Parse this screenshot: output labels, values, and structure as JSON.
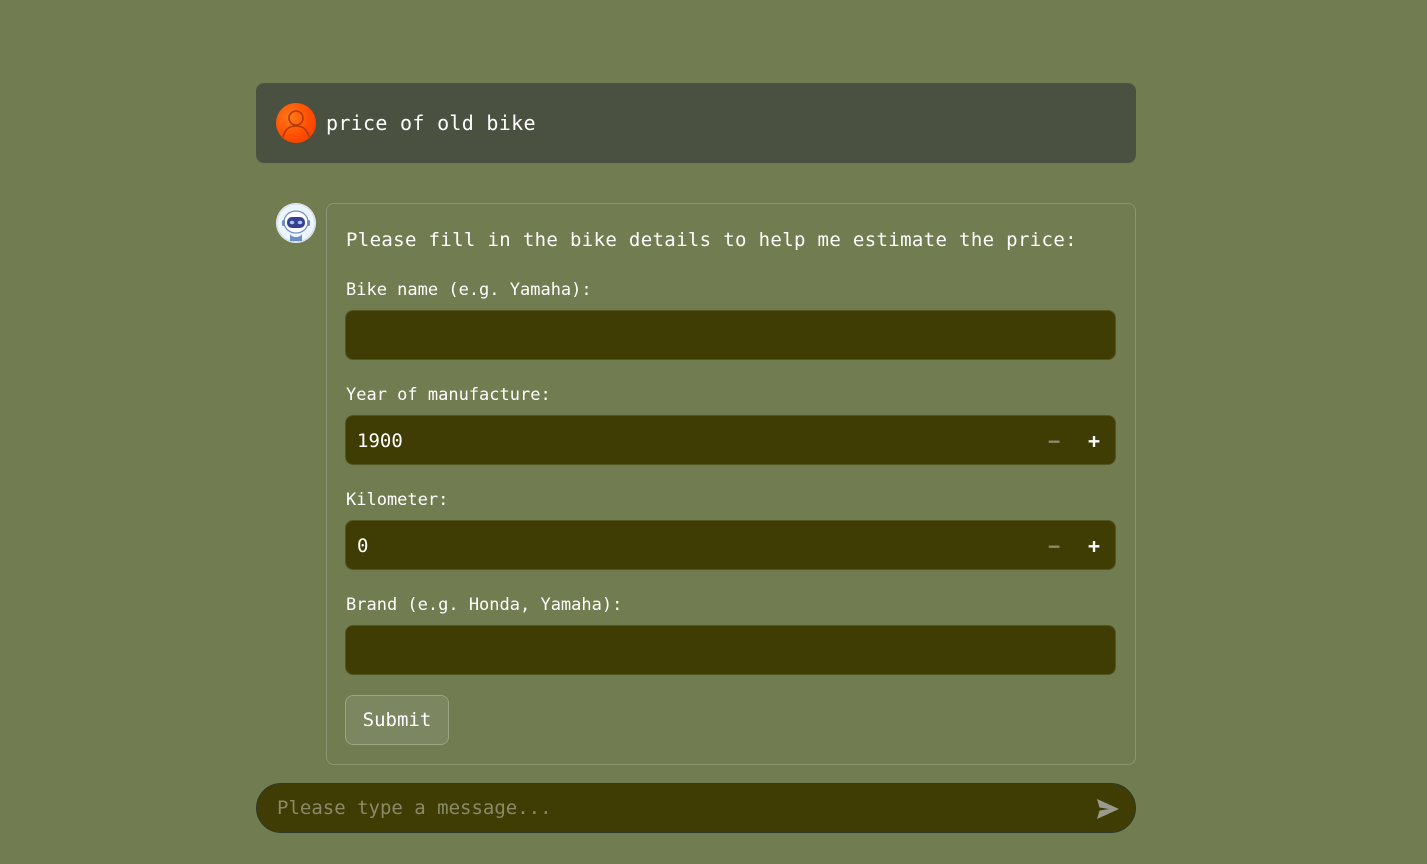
{
  "conversation": {
    "user_message": {
      "text": "price of old bike",
      "avatar_icon": "user-icon",
      "avatar_color": "#ff5a00"
    },
    "bot_message": {
      "avatar_icon": "robot-icon",
      "intro": "Please fill in the bike details to help me estimate the price:",
      "form": {
        "bike_name": {
          "label": "Bike name (e.g. Yamaha):",
          "value": ""
        },
        "year": {
          "label": "Year of manufacture:",
          "value": "1900",
          "decrement": "−",
          "increment": "+"
        },
        "kilometer": {
          "label": "Kilometer:",
          "value": "0",
          "decrement": "−",
          "increment": "+"
        },
        "brand": {
          "label": "Brand (e.g. Honda, Yamaha):",
          "value": ""
        },
        "submit_label": "Submit"
      }
    }
  },
  "composer": {
    "placeholder": "Please type a message...",
    "send_icon": "send-icon"
  },
  "colors": {
    "page_background": "#717c50",
    "user_bubble": "#4b5141",
    "input_background": "#403d04",
    "text": "#ffffff"
  }
}
